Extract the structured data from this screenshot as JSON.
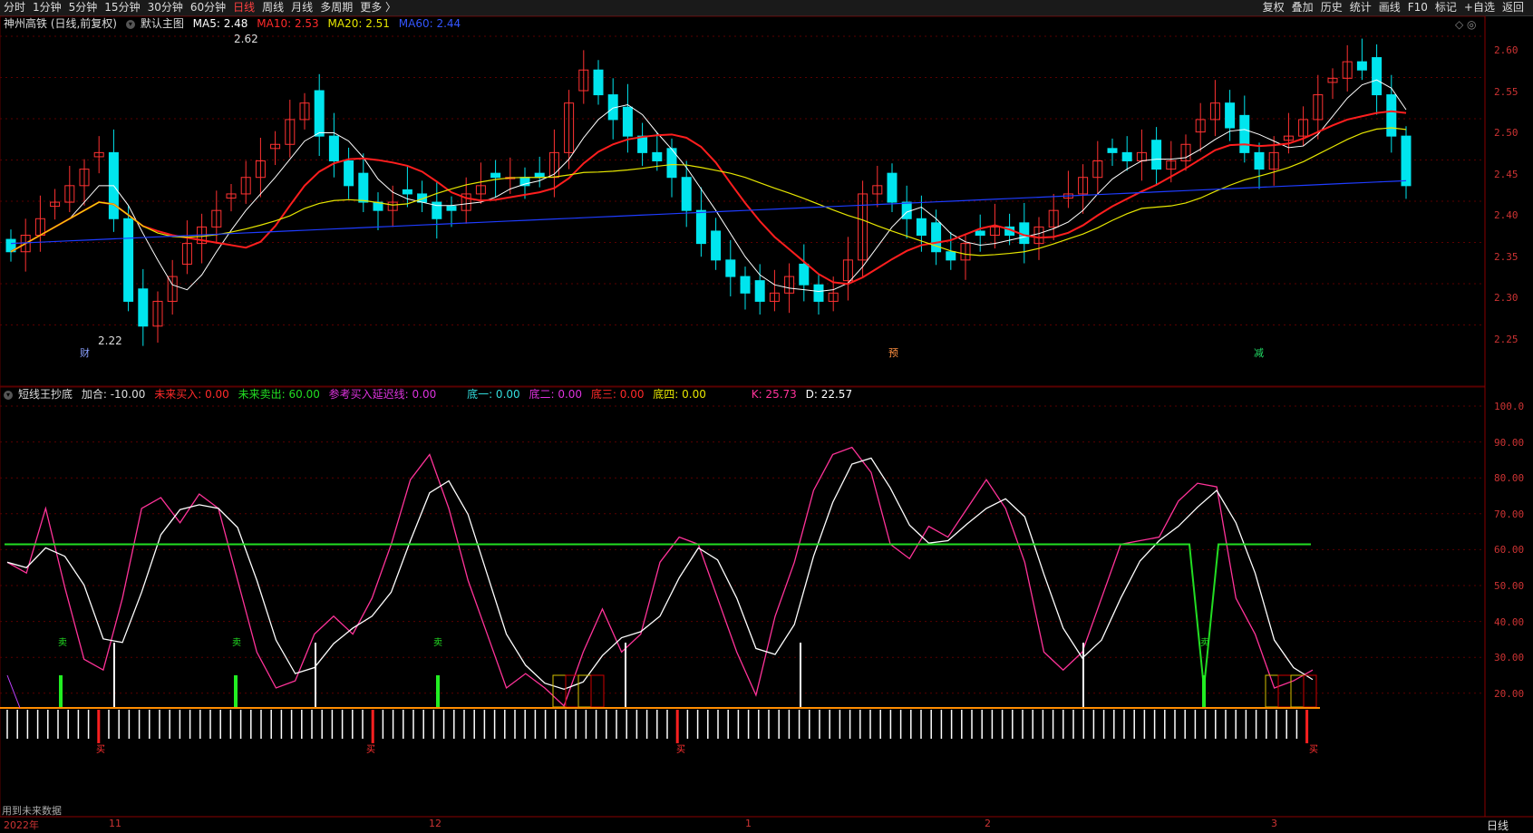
{
  "timeframes": [
    "分时",
    "1分钟",
    "5分钟",
    "15分钟",
    "30分钟",
    "60分钟",
    "日线",
    "周线",
    "月线",
    "多周期",
    "更多 〉"
  ],
  "active_timeframe": "日线",
  "toolbar_right": [
    "复权",
    "叠加",
    "历史",
    "统计",
    "画线",
    "F10",
    "标记",
    "+自选",
    "返回"
  ],
  "main": {
    "title": "神州高铁 (日线,前复权)",
    "template": "默认主图",
    "ma5": "MA5: 2.48",
    "ma10": "MA10: 2.53",
    "ma20": "MA20: 2.51",
    "ma60": "MA60: 2.44",
    "high_label": "2.62",
    "low_label": "2.22",
    "markers": [
      "财",
      "预",
      "减"
    ],
    "axis_ticks": [
      "2.60",
      "2.55",
      "2.50",
      "2.45",
      "2.40",
      "2.35",
      "2.30",
      "2.25"
    ],
    "corner": "◇ ◎"
  },
  "indicator": {
    "name": "短线王抄底",
    "jiahe": "加合: -10.00",
    "future_buy": "未来买入: 0.00",
    "future_sell": "未来卖出: 60.00",
    "ref_line": "参考买入延迟线: 0.00",
    "di1": "底一: 0.00",
    "di2": "底二: 0.00",
    "di3": "底三: 0.00",
    "di4": "底四: 0.00",
    "k": "K: 25.73",
    "d": "D: 22.57",
    "axis_ticks": [
      "100.0",
      "90.00",
      "80.00",
      "70.00",
      "60.00",
      "50.00",
      "40.00",
      "30.00",
      "20.00"
    ],
    "sell_mark": "卖",
    "buy_mark": "买",
    "note": "用到未来数据"
  },
  "dates": [
    "2022年",
    "11",
    "12",
    "1",
    "2",
    "3"
  ],
  "bottom_tab": "日线",
  "colors": {
    "up": "#ff3232",
    "down": "#00e5ee",
    "ma5": "#ffffff",
    "ma10": "#ff1e1e",
    "ma20": "#e6e600",
    "ma60": "#1e3cff",
    "k": "#ff3399",
    "d": "#ffffff",
    "sell_line": "#22dd22",
    "grid": "#5a0000"
  }
}
